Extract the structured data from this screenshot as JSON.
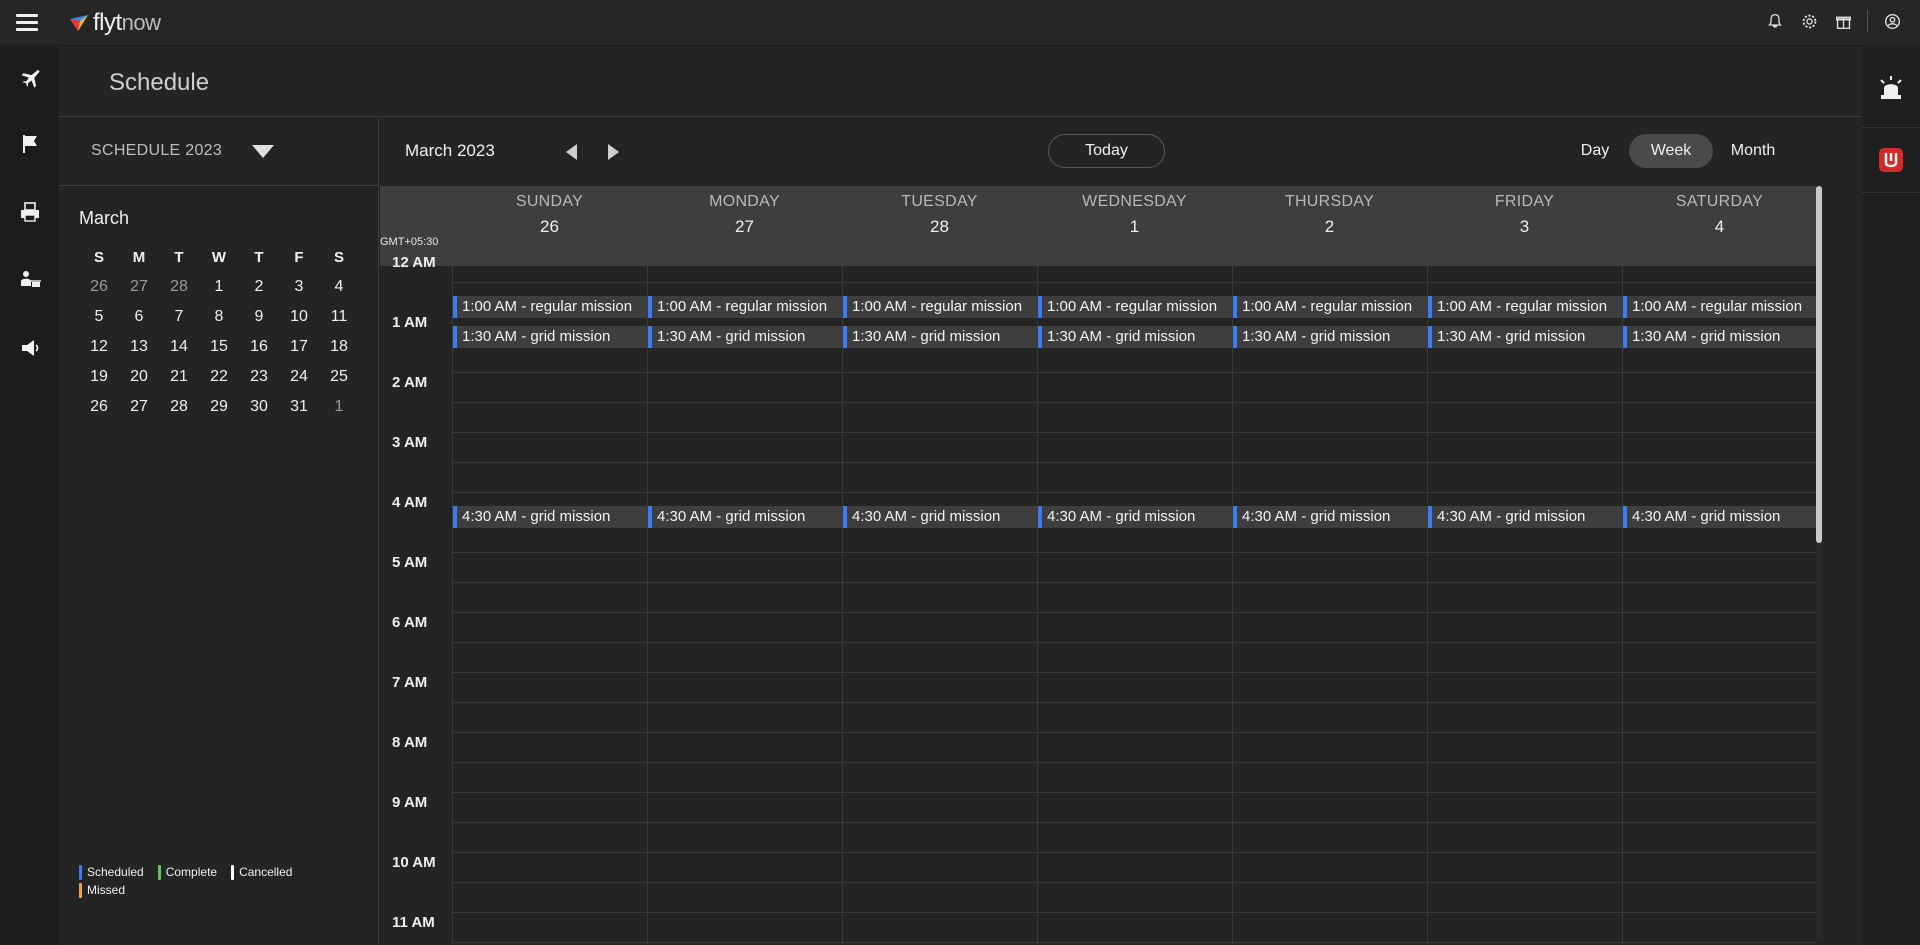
{
  "app": {
    "logo_main": "flyt",
    "logo_sub": "now"
  },
  "topbar": {
    "icons": [
      "bell-icon",
      "gear-icon",
      "gift-icon",
      "user-circle-icon"
    ]
  },
  "leftnav": {
    "items": [
      "plane-icon",
      "flag-icon",
      "printer-icon",
      "user-drone-icon",
      "megaphone-icon"
    ]
  },
  "page": {
    "title": "Schedule"
  },
  "sidepanel": {
    "schedule_name": "SCHEDULE 2023",
    "mini_month": "March",
    "weekday_heads": [
      "S",
      "M",
      "T",
      "W",
      "T",
      "F",
      "S"
    ],
    "weeks": [
      [
        {
          "d": "26",
          "muted": true
        },
        {
          "d": "27",
          "muted": true
        },
        {
          "d": "28",
          "muted": true
        },
        {
          "d": "1"
        },
        {
          "d": "2"
        },
        {
          "d": "3"
        },
        {
          "d": "4"
        }
      ],
      [
        {
          "d": "5"
        },
        {
          "d": "6"
        },
        {
          "d": "7"
        },
        {
          "d": "8"
        },
        {
          "d": "9"
        },
        {
          "d": "10"
        },
        {
          "d": "11"
        }
      ],
      [
        {
          "d": "12"
        },
        {
          "d": "13"
        },
        {
          "d": "14"
        },
        {
          "d": "15"
        },
        {
          "d": "16"
        },
        {
          "d": "17"
        },
        {
          "d": "18"
        }
      ],
      [
        {
          "d": "19"
        },
        {
          "d": "20"
        },
        {
          "d": "21"
        },
        {
          "d": "22"
        },
        {
          "d": "23"
        },
        {
          "d": "24"
        },
        {
          "d": "25"
        }
      ],
      [
        {
          "d": "26"
        },
        {
          "d": "27"
        },
        {
          "d": "28"
        },
        {
          "d": "29"
        },
        {
          "d": "30"
        },
        {
          "d": "31"
        },
        {
          "d": "1",
          "muted": true
        }
      ]
    ],
    "legend": [
      {
        "label": "Scheduled",
        "color": "#3d7bf0"
      },
      {
        "label": "Complete",
        "color": "#5ec45e"
      },
      {
        "label": "Cancelled",
        "color": "#ffffff"
      },
      {
        "label": "Missed",
        "color": "#f0a040"
      }
    ]
  },
  "calendar": {
    "month_label": "March 2023",
    "today_label": "Today",
    "views": {
      "day": "Day",
      "week": "Week",
      "month": "Month"
    },
    "active_view": "Week",
    "timezone": "GMT+05:30",
    "days": [
      {
        "name": "SUNDAY",
        "num": "26"
      },
      {
        "name": "MONDAY",
        "num": "27"
      },
      {
        "name": "TUESDAY",
        "num": "28"
      },
      {
        "name": "WEDNESDAY",
        "num": "1"
      },
      {
        "name": "THURSDAY",
        "num": "2"
      },
      {
        "name": "FRIDAY",
        "num": "3"
      },
      {
        "name": "SATURDAY",
        "num": "4"
      }
    ],
    "hours": [
      "12 AM",
      "1 AM",
      "2 AM",
      "3 AM",
      "4 AM",
      "5 AM",
      "6 AM",
      "7 AM",
      "8 AM",
      "9 AM",
      "10 AM",
      "11 AM"
    ],
    "events": [
      {
        "label": "1:00 AM - regular mission",
        "hour": 1,
        "minute": 0,
        "status": "Scheduled"
      },
      {
        "label": "1:30 AM - grid mission",
        "hour": 1,
        "minute": 30,
        "status": "Scheduled"
      },
      {
        "label": "4:30 AM - grid mission",
        "hour": 4,
        "minute": 30,
        "status": "Scheduled"
      }
    ]
  }
}
